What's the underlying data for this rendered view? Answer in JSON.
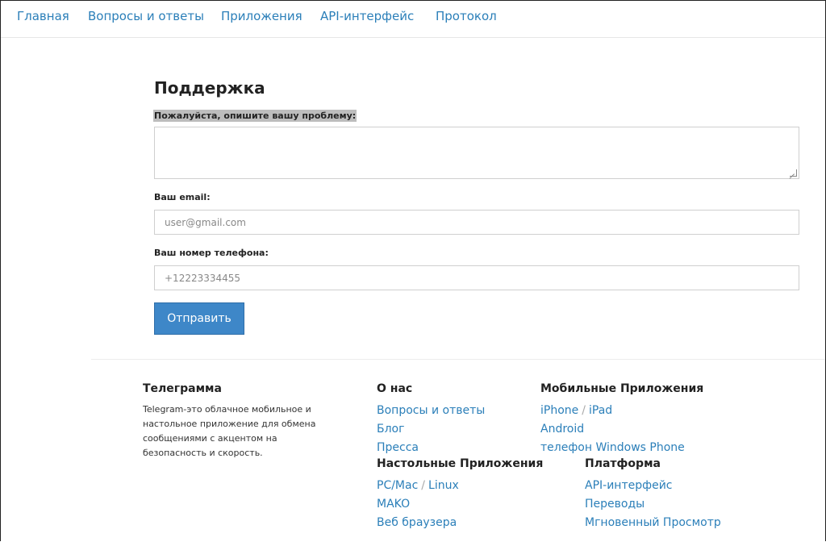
{
  "nav": {
    "items": [
      "Главная",
      "Вопросы и ответы",
      "Приложения",
      "API-интерфейс",
      "Протокол"
    ]
  },
  "form": {
    "title": "Поддержка",
    "problem_label": "Пожалуйста, опишите вашу проблему:",
    "problem_value": "",
    "email_label": "Ваш email:",
    "email_placeholder": "user@gmail.com",
    "phone_label": "Ваш номер телефона:",
    "phone_placeholder": "+12223334455",
    "submit_label": "Отправить"
  },
  "footer": {
    "about_title": "Телеграмма",
    "about_text": "Telegram-это облачное мобильное и настольное приложение для обмена сообщениями с акцентом на безопасность и скорость.",
    "col_about": {
      "title": "О нас",
      "links": [
        "Вопросы и ответы",
        "Блог",
        "Пресса"
      ]
    },
    "col_mobile": {
      "title": "Мобильные Приложения",
      "iphone": "iPhone",
      "ipad": "iPad",
      "sep": "/",
      "links": [
        "Android",
        "телефон Windows Phone"
      ]
    },
    "col_desktop": {
      "title": "Настольные Приложения",
      "pc": "PC/Mac",
      "linux": "Linux",
      "sep": "/",
      "links": [
        "MAKO",
        "Веб браузера"
      ]
    },
    "col_platform": {
      "title": "Платформа",
      "links": [
        "API-интерфейс",
        "Переводы",
        "Мгновенный Просмотр"
      ]
    }
  },
  "colors": {
    "link": "#2b7fb9",
    "button": "#3e87c8"
  }
}
